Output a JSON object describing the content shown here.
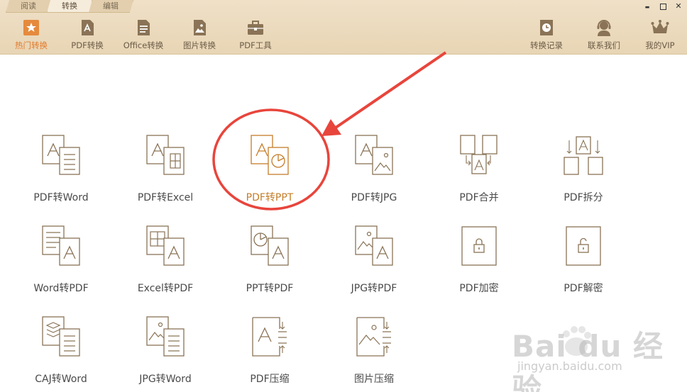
{
  "tabs": [
    {
      "label": "阅读"
    },
    {
      "label": "转换"
    },
    {
      "label": "编辑"
    }
  ],
  "window_controls": {
    "minimize": "▬"
  },
  "toolbar": {
    "left": [
      {
        "label": "热门转换",
        "icon": "star-icon"
      },
      {
        "label": "PDF转换",
        "icon": "pdf-icon"
      },
      {
        "label": "Office转换",
        "icon": "document-icon"
      },
      {
        "label": "图片转换",
        "icon": "image-icon"
      },
      {
        "label": "PDF工具",
        "icon": "toolbox-icon"
      }
    ],
    "right": [
      {
        "label": "转换记录",
        "icon": "clock-icon"
      },
      {
        "label": "联系我们",
        "icon": "support-icon"
      },
      {
        "label": "我的VIP",
        "icon": "crown-icon"
      }
    ]
  },
  "features": [
    {
      "label": "PDF转Word"
    },
    {
      "label": "PDF转Excel"
    },
    {
      "label": "PDF转PPT"
    },
    {
      "label": "PDF转JPG"
    },
    {
      "label": "PDF合并"
    },
    {
      "label": "PDF拆分"
    },
    {
      "label": "Word转PDF"
    },
    {
      "label": "Excel转PDF"
    },
    {
      "label": "PPT转PDF"
    },
    {
      "label": "JPG转PDF"
    },
    {
      "label": "PDF加密"
    },
    {
      "label": "PDF解密"
    },
    {
      "label": "CAJ转Word"
    },
    {
      "label": "JPG转Word"
    },
    {
      "label": "PDF压缩"
    },
    {
      "label": "图片压缩"
    }
  ],
  "watermark": {
    "logo": "Bai du 经验",
    "url": "jingyan.baidu.com"
  },
  "colors": {
    "accent": "#e27a2a",
    "toolbar_bg": "#ecdcbf",
    "icon_stroke": "#8a7356",
    "highlight_text": "#c57d28",
    "annotation": "#e8453c"
  }
}
